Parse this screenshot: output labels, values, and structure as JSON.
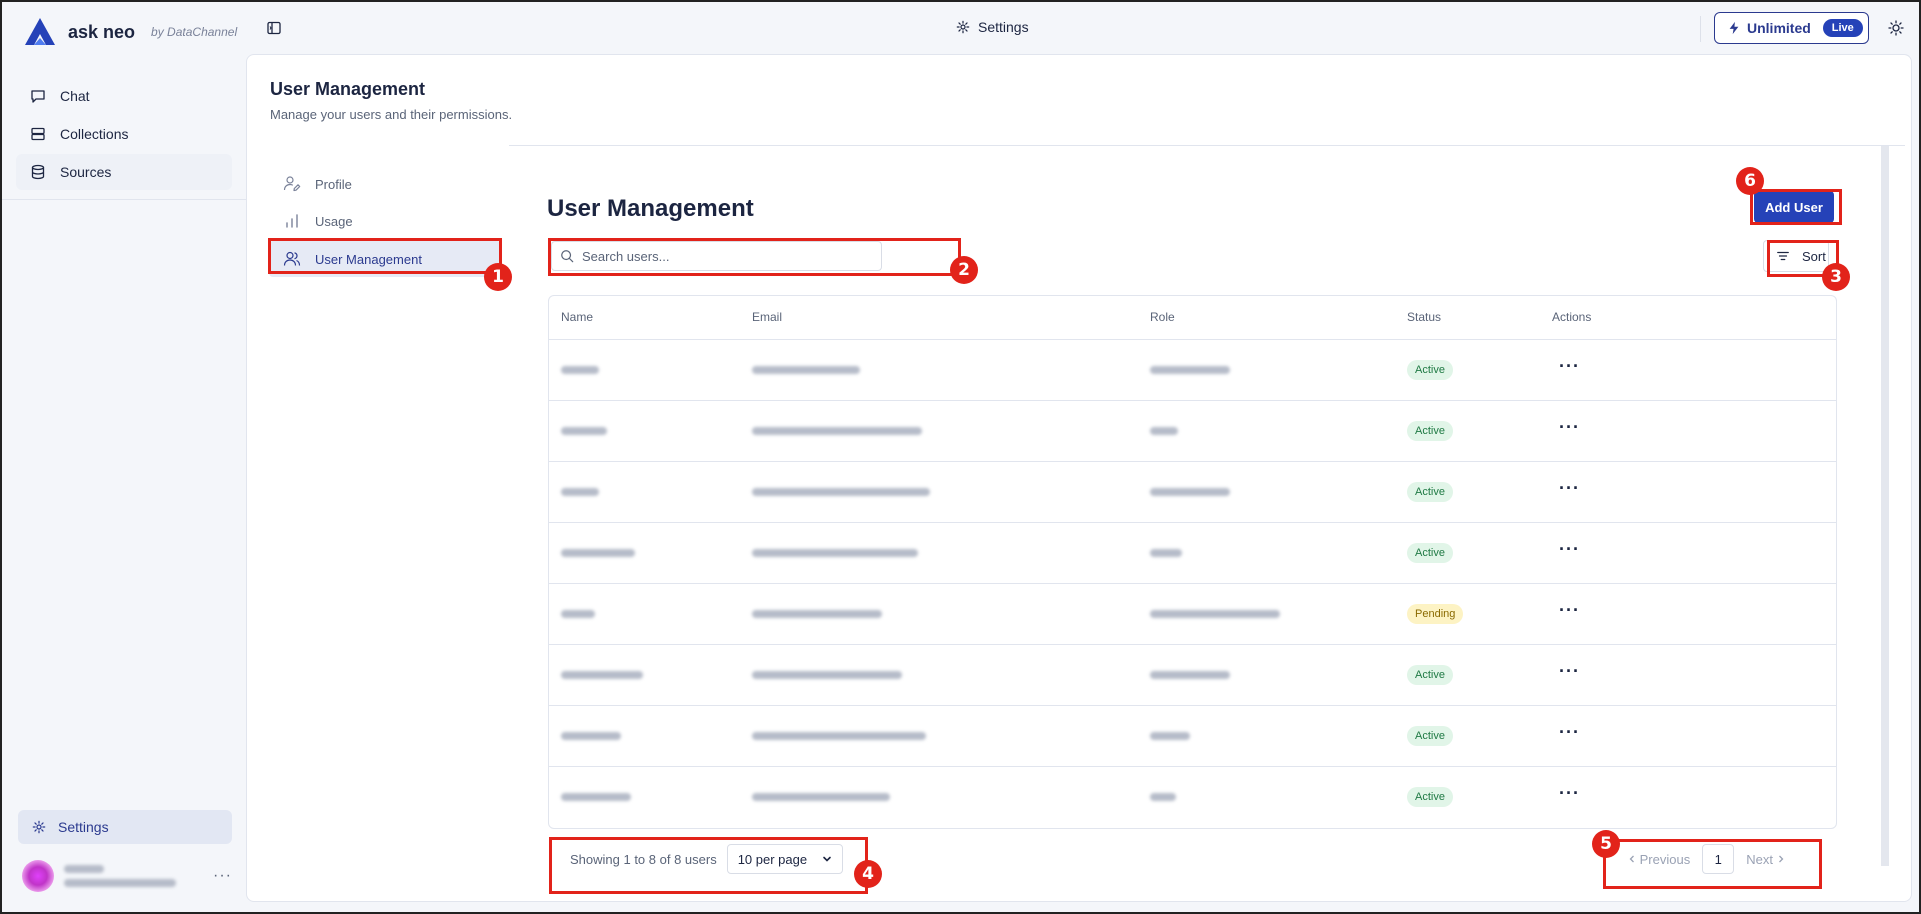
{
  "brand": {
    "name": "ask neo",
    "byline": "by DataChannel"
  },
  "nav": {
    "items": [
      {
        "label": "Chat",
        "icon": "chat-bubble-icon"
      },
      {
        "label": "Collections",
        "icon": "layers-icon"
      },
      {
        "label": "Sources",
        "icon": "database-icon"
      }
    ],
    "settings_label": "Settings"
  },
  "topbar": {
    "title": "Settings",
    "plan_label": "Unlimited",
    "plan_badge": "Live"
  },
  "page": {
    "title": "User Management",
    "subtitle": "Manage your users and their permissions."
  },
  "settings_nav": [
    {
      "label": "Profile",
      "icon": "user-edit-icon"
    },
    {
      "label": "Usage",
      "icon": "bar-chart-icon"
    },
    {
      "label": "User Management",
      "icon": "users-icon"
    }
  ],
  "content": {
    "title": "User Management",
    "add_user_label": "Add User",
    "search_placeholder": "Search users...",
    "sort_label": "Sort"
  },
  "table": {
    "columns": [
      "Name",
      "Email",
      "Role",
      "Status",
      "Actions"
    ],
    "rows": [
      {
        "status": "Active"
      },
      {
        "status": "Active"
      },
      {
        "status": "Active"
      },
      {
        "status": "Active"
      },
      {
        "status": "Pending"
      },
      {
        "status": "Active"
      },
      {
        "status": "Active"
      },
      {
        "status": "Active"
      }
    ]
  },
  "pagination": {
    "summary": "Showing 1 to 8 of 8 users",
    "per_page": "10 per page",
    "previous_label": "Previous",
    "current_page": "1",
    "next_label": "Next"
  },
  "annotations": [
    "1",
    "2",
    "3",
    "4",
    "5",
    "6"
  ],
  "colors": {
    "accent": "#2542b8",
    "annotation": "#e2231a",
    "active_bg": "#e1f5e8",
    "pending_bg": "#fdf3c4"
  }
}
